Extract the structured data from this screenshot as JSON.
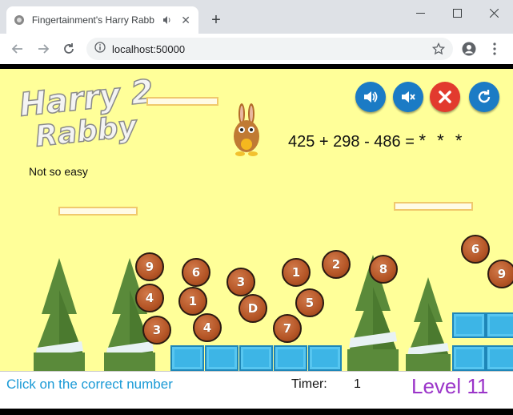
{
  "browser": {
    "tab_title": "Fingertainment's Harry Rabb",
    "url": "localhost:50000",
    "colors": {
      "chrome_bg": "#dee1e6",
      "toolbar_bg": "#ffffff"
    }
  },
  "game": {
    "logo_line1": "Harry 2",
    "logo_line2": "Rabby",
    "difficulty": "Not so easy",
    "equation": "425 + 298 - 486 =",
    "answer_placeholder": "* * *",
    "balls": [
      "9",
      "6",
      "4",
      "1",
      "3",
      "3",
      "1",
      "2",
      "8",
      "D",
      "5",
      "4",
      "7",
      "6",
      "9"
    ],
    "controls": [
      "sound-on",
      "mute",
      "close",
      "restart"
    ],
    "colors": {
      "background": "#ffff99",
      "ball": "#b45526",
      "block": "#3db5e6",
      "tree": "#5a8a3a"
    }
  },
  "status_bar": {
    "instruction": "Click on the correct number",
    "timer_label": "Timer:",
    "timer_value": "1",
    "level": "Level 11"
  }
}
